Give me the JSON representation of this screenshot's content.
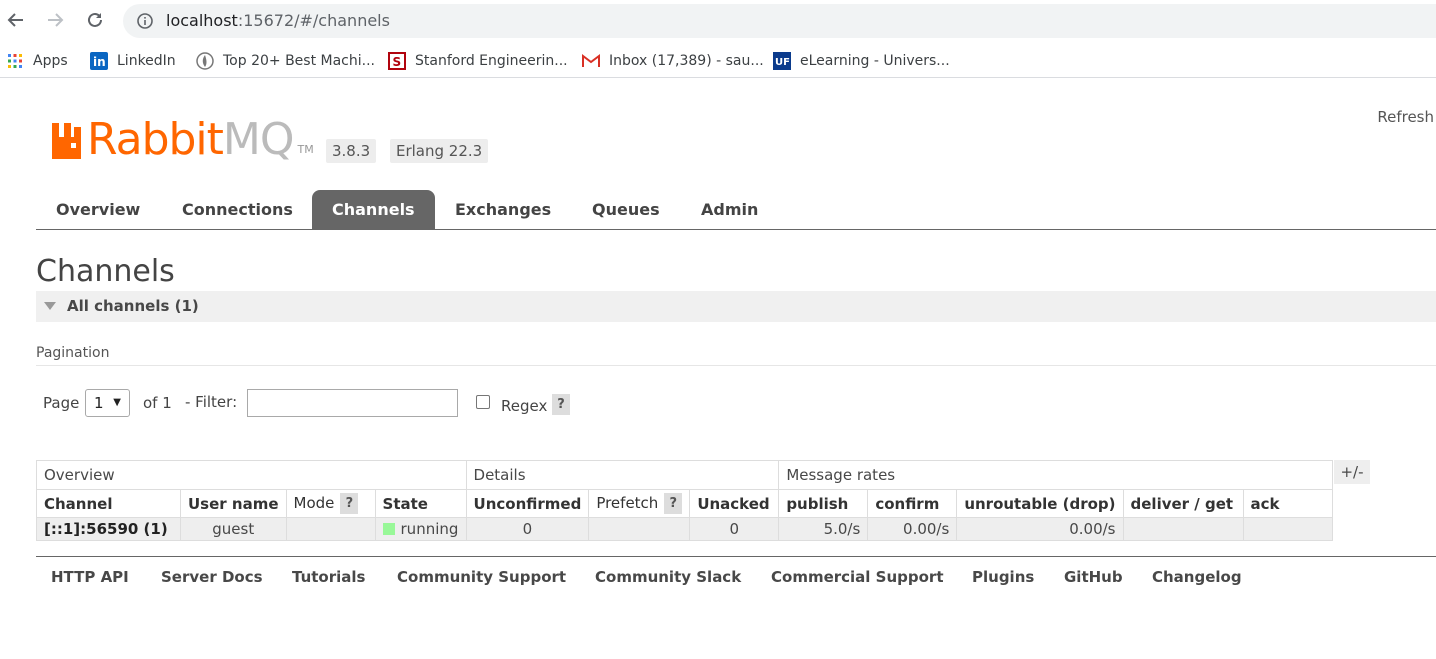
{
  "browser": {
    "url_host": "localhost",
    "url_path": ":15672/#/channels",
    "bookmarks": [
      {
        "label": "Apps",
        "icon": "apps-grid-icon"
      },
      {
        "label": "LinkedIn",
        "icon": "linkedin-icon"
      },
      {
        "label": "Top 20+ Best Machi...",
        "icon": "globe-icon"
      },
      {
        "label": "Stanford Engineerin...",
        "icon": "stanford-icon"
      },
      {
        "label": "Inbox (17,389) - sau...",
        "icon": "gmail-icon"
      },
      {
        "label": "eLearning - Univers...",
        "icon": "uf-icon"
      }
    ]
  },
  "header": {
    "logo_main": "Rabbit",
    "logo_mq": "MQ",
    "logo_tm": "TM",
    "version": "3.8.3",
    "erlang": "Erlang 22.3",
    "refresh": "Refresh"
  },
  "tabs": [
    "Overview",
    "Connections",
    "Channels",
    "Exchanges",
    "Queues",
    "Admin"
  ],
  "active_tab": "Channels",
  "page": {
    "title": "Channels",
    "section": "All channels (1)",
    "pagination_title": "Pagination",
    "page_label": "Page",
    "page_value": "1",
    "of_label": "of 1",
    "filter_label": "- Filter:",
    "regex_label": "Regex",
    "help": "?"
  },
  "table": {
    "groups": [
      "Overview",
      "Details",
      "Message rates"
    ],
    "columns": [
      "Channel",
      "User name",
      "Mode",
      "State",
      "Unconfirmed",
      "Prefetch",
      "Unacked",
      "publish",
      "confirm",
      "unroutable (drop)",
      "deliver / get",
      "ack"
    ],
    "rows": [
      {
        "channel": "[::1]:56590 (1)",
        "user": "guest",
        "mode": "",
        "state": "running",
        "unconfirmed": "0",
        "prefetch": "",
        "unacked": "0",
        "publish": "5.0/s",
        "confirm": "0.00/s",
        "unroutable": "0.00/s",
        "deliver_get": "",
        "ack": ""
      }
    ],
    "plusminus": "+/-"
  },
  "footer": [
    "HTTP API",
    "Server Docs",
    "Tutorials",
    "Community Support",
    "Community Slack",
    "Commercial Support",
    "Plugins",
    "GitHub",
    "Changelog"
  ],
  "colors": {
    "brand": "#ff6600",
    "tab_active": "#666666",
    "state_running": "#98f898"
  }
}
